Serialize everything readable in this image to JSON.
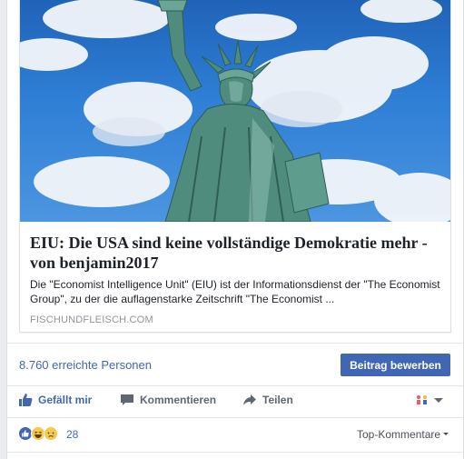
{
  "preview": {
    "title": "EIU: Die USA sind keine vollständige Demokratie mehr - von benjamin2017",
    "description": "Die \"Economist Intelligence Unit\" (EIU) ist der Informationsdienst der \"The Economist Group\", zu der die auflagenstarke Zeitschrift \"The Economist ...",
    "domain": "FISCHUNDFLEISCH.COM"
  },
  "reach": {
    "text": "8.760 erreichte Personen",
    "promote_label": "Beitrag bewerben"
  },
  "actions": {
    "like_label": "Gefällt mir",
    "comment_label": "Kommentieren",
    "share_label": "Teilen"
  },
  "reactions": {
    "count": "28",
    "sort_label": "Top-Kommentare"
  },
  "colors": {
    "brand": "#4267b2",
    "text_muted": "#606770"
  }
}
